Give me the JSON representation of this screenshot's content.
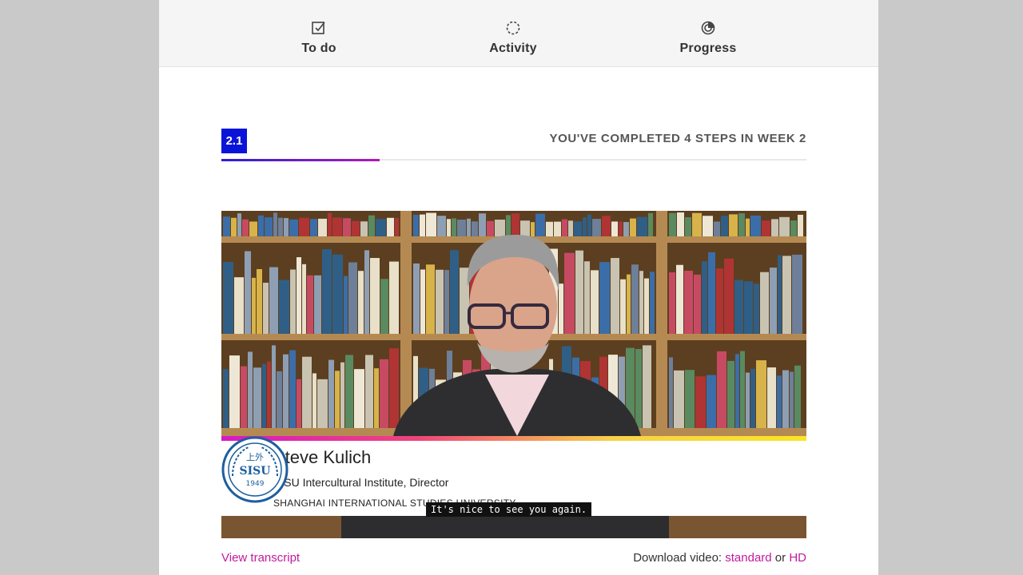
{
  "nav": {
    "todo": {
      "label": "To do",
      "icon": "checkbox-edit-icon"
    },
    "activity": {
      "label": "Activity",
      "icon": "activity-spinner-icon"
    },
    "progress": {
      "label": "Progress",
      "icon": "progress-ring-icon"
    }
  },
  "step": {
    "badge": "2.1",
    "completed_text": "YOU'VE COMPLETED 4 STEPS IN WEEK 2",
    "progress_fraction": 0.27
  },
  "video": {
    "speaker_name": "Steve Kulich",
    "speaker_role": "SISU Intercultural Institute, Director",
    "speaker_org": "SHANGHAI INTERNATIONAL STUDIES UNIVERSITY",
    "caption": "It's nice to see you again.",
    "logo": {
      "top_text": "上外",
      "middle_text": "SISU",
      "year": "1949"
    }
  },
  "links": {
    "view_transcript": "View transcript",
    "download_prefix": "Download video: ",
    "standard": "standard",
    "or": " or ",
    "hd": "HD"
  },
  "colors": {
    "badge": "#0a14d8",
    "link": "#c21a9e"
  }
}
